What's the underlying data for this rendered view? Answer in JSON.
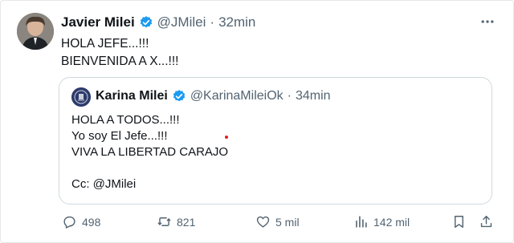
{
  "tweet": {
    "author_name": "Javier Milei",
    "author_handle": "@JMilei",
    "separator": "·",
    "time": "32min",
    "lines": [
      "HOLA JEFE...!!!",
      "BIENVENIDA A X...!!!"
    ]
  },
  "quote": {
    "author_name": "Karina Milei",
    "author_handle": "@KarinaMileiOk",
    "separator": "·",
    "time": "34min",
    "lines": [
      "HOLA A TODOS...!!!",
      "Yo soy El Jefe...!!!",
      "VIVA LA LIBERTAD CARAJO",
      "",
      "Cc: @JMilei"
    ]
  },
  "actions": {
    "replies": "498",
    "reposts": "821",
    "likes": "5 mil",
    "views": "142 mil"
  },
  "colors": {
    "verified": "#1d9bf0",
    "muted": "#536471",
    "border": "#cfd9de"
  },
  "icons": [
    "verified-badge-icon",
    "more-icon",
    "reply-icon",
    "repost-icon",
    "like-icon",
    "views-icon",
    "bookmark-icon",
    "share-icon"
  ]
}
